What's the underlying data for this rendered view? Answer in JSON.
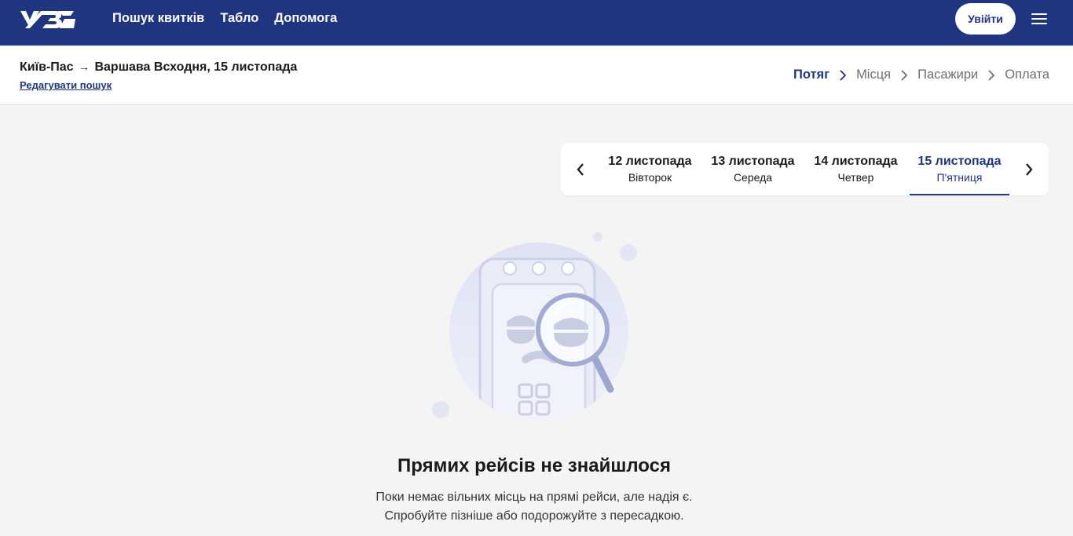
{
  "header": {
    "nav": [
      "Пошук квитків",
      "Табло",
      "Допомога"
    ],
    "login_label": "Увійти",
    "brand_color": "#1f3580"
  },
  "subheader": {
    "route_from": "Київ-Пас",
    "route_to": "Варшава Всходня, 15 листопада",
    "edit_label": "Редагувати пошук",
    "steps": [
      "Потяг",
      "Місця",
      "Пасажири",
      "Оплата"
    ],
    "active_step": "Потяг"
  },
  "dates": [
    {
      "date": "12 листопада",
      "weekday": "Вівторок"
    },
    {
      "date": "13 листопада",
      "weekday": "Середа"
    },
    {
      "date": "14 листопада",
      "weekday": "Четвер"
    },
    {
      "date": "15 листопада",
      "weekday": "П'ятниця"
    }
  ],
  "active_date": "15 листопада",
  "empty": {
    "title": "Прямих рейсів не знайшлося",
    "line1": "Поки немає вільних місць на прямі рейси, але надія є.",
    "line2": "Спробуйте пізніше або подорожуйте з пересадкою."
  }
}
